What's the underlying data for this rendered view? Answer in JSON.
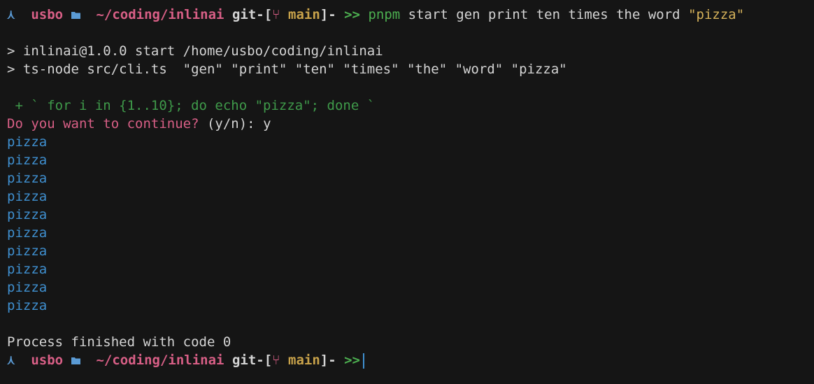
{
  "prompt": {
    "arrow": "⋏",
    "user": "usbo",
    "path": "~/coding/inlinai",
    "git_prefix": "git-[",
    "branch_icon": "⑂",
    "branch": "main",
    "git_suffix": "]-",
    "prompt_symbol": ">>"
  },
  "command": {
    "program": "pnpm",
    "args": "start gen print ten times the word",
    "quoted": "\"pizza\""
  },
  "script_output": {
    "line1": "> inlinai@1.0.0 start /home/usbo/coding/inlinai",
    "line2": "> ts-node src/cli.ts  \"gen\" \"print\" \"ten\" \"times\" \"the\" \"word\" \"pizza\""
  },
  "suggestion": " + ` for i in {1..10}; do echo \"pizza\"; done `",
  "question": {
    "text": "Do you want to continue? ",
    "options": "(y/n): ",
    "answer": "y"
  },
  "output_lines": [
    "pizza",
    "pizza",
    "pizza",
    "pizza",
    "pizza",
    "pizza",
    "pizza",
    "pizza",
    "pizza",
    "pizza"
  ],
  "finish_message": "Process finished with code 0",
  "colors": {
    "background": "#151515",
    "user": "#d85f86",
    "path": "#d85f86",
    "branch": "#c8a24a",
    "prompt": "#4caf50",
    "output": "#3f8fcf",
    "suggestion": "#3f9a4a"
  }
}
